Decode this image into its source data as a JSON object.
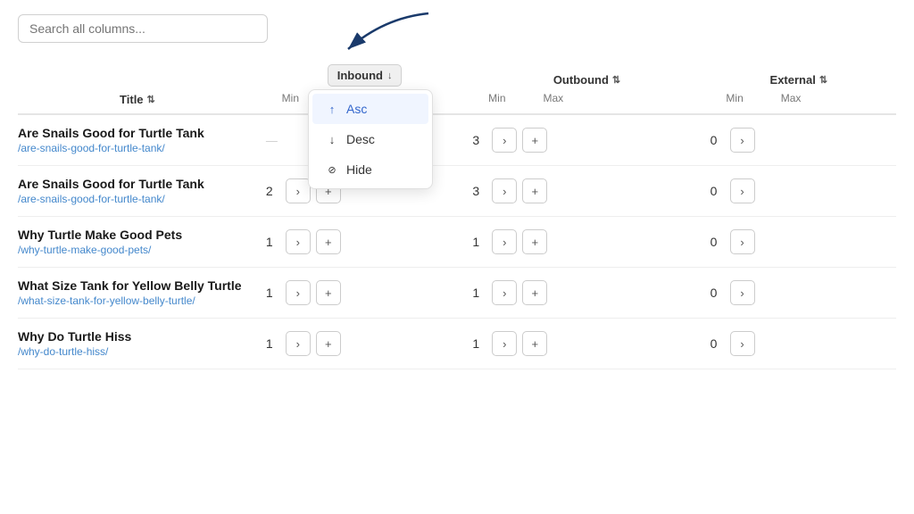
{
  "search": {
    "placeholder": "Search all columns..."
  },
  "arrow": {
    "visible": true
  },
  "columns": {
    "title": {
      "label": "Title",
      "sort_indicator": "↕"
    },
    "inbound": {
      "label": "Inbound",
      "sort_indicator": "↓",
      "active": true
    },
    "outbound": {
      "label": "Outbound",
      "sort_indicator": "↕"
    },
    "external": {
      "label": "External",
      "sort_indicator": "↕"
    }
  },
  "dropdown": {
    "items": [
      {
        "label": "Asc",
        "icon": "↑",
        "active": true
      },
      {
        "label": "Desc",
        "icon": "↓",
        "active": false
      },
      {
        "label": "Hide",
        "icon": "◌",
        "active": false
      }
    ]
  },
  "min_max": {
    "min_label": "Min",
    "max_label": "Max"
  },
  "rows": [
    {
      "title": "Are Snails Good for Turtle Tank",
      "url": "/are-snails-good-for-turtle-tank/",
      "inbound_min": null,
      "outbound_min": 3,
      "external_min": 0
    },
    {
      "title": "Are Snails Good for Turtle Tank",
      "url": "/are-snails-good-for-turtle-tank/",
      "inbound_min": 2,
      "outbound_min": 3,
      "external_min": 0
    },
    {
      "title": "Why Turtle Make Good Pets",
      "url": "/why-turtle-make-good-pets/",
      "inbound_min": 1,
      "outbound_min": 1,
      "external_min": 0
    },
    {
      "title": "What Size Tank for Yellow Belly Turtle",
      "url": "/what-size-tank-for-yellow-belly-turtle/",
      "inbound_min": 1,
      "outbound_min": 1,
      "external_min": 0
    },
    {
      "title": "Why Do Turtle Hiss",
      "url": "/why-do-turtle-hiss/",
      "inbound_min": 1,
      "outbound_min": 1,
      "external_min": 0
    }
  ]
}
